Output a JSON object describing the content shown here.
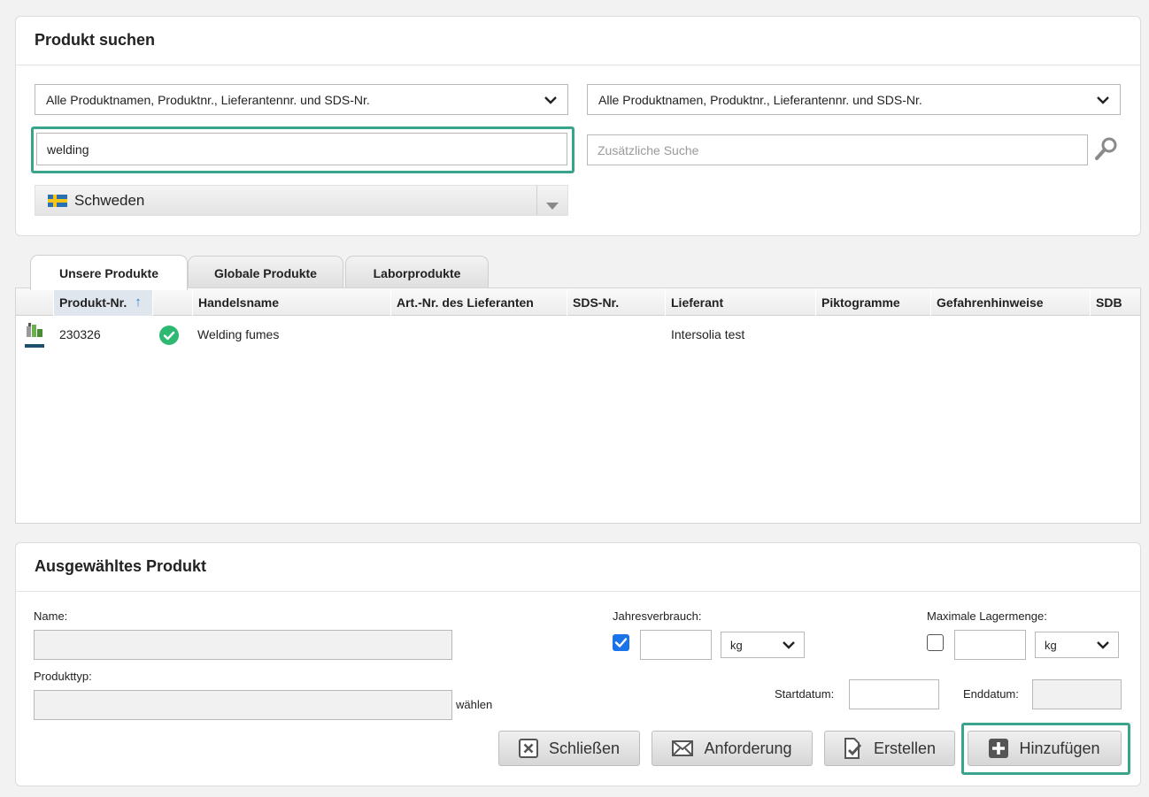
{
  "search_panel": {
    "title": "Produkt suchen",
    "left_dropdown": "Alle Produktnamen, Produktnr., Lieferantennr. und SDS-Nr.",
    "right_dropdown": "Alle Produktnamen, Produktnr., Lieferantennr. und SDS-Nr.",
    "search_value": "welding",
    "additional_placeholder": "Zusätzliche Suche",
    "country": "Schweden"
  },
  "tabs": [
    {
      "label": "Unsere Produkte",
      "active": true
    },
    {
      "label": "Globale Produkte",
      "active": false
    },
    {
      "label": "Laborprodukte",
      "active": false
    }
  ],
  "table": {
    "columns": [
      "Produkt-Nr.",
      "Handelsname",
      "Art.-Nr. des Lieferanten",
      "SDS-Nr.",
      "Lieferant",
      "Piktogramme",
      "Gefahrenhinweise",
      "SDB"
    ],
    "sort_indicator": "↑",
    "rows": [
      {
        "product_no": "230326",
        "status": "approved",
        "trade_name": "Welding fumes",
        "supplier_art_no": "",
        "sds_no": "",
        "supplier": "Intersolia test",
        "pictograms": "",
        "hazard_statements": "",
        "sdb": ""
      }
    ]
  },
  "selected_panel": {
    "title": "Ausgewähltes Produkt",
    "name_label": "Name:",
    "product_type_label": "Produkttyp:",
    "choose_link": "wählen",
    "annual_consumption_label": "Jahresverbrauch:",
    "annual_checked": true,
    "annual_unit": "kg",
    "max_storage_label": "Maximale Lagermenge:",
    "max_checked": false,
    "max_unit": "kg",
    "start_date_label": "Startdatum:",
    "end_date_label": "Enddatum:"
  },
  "buttons": {
    "close": "Schließen",
    "request": "Anforderung",
    "create": "Erstellen",
    "add": "Hinzufügen"
  },
  "colors": {
    "highlight": "#3aa38b",
    "check_green": "#2eb872",
    "checkbox_blue": "#1a73e8",
    "sort_arrow": "#2a7fd4"
  }
}
